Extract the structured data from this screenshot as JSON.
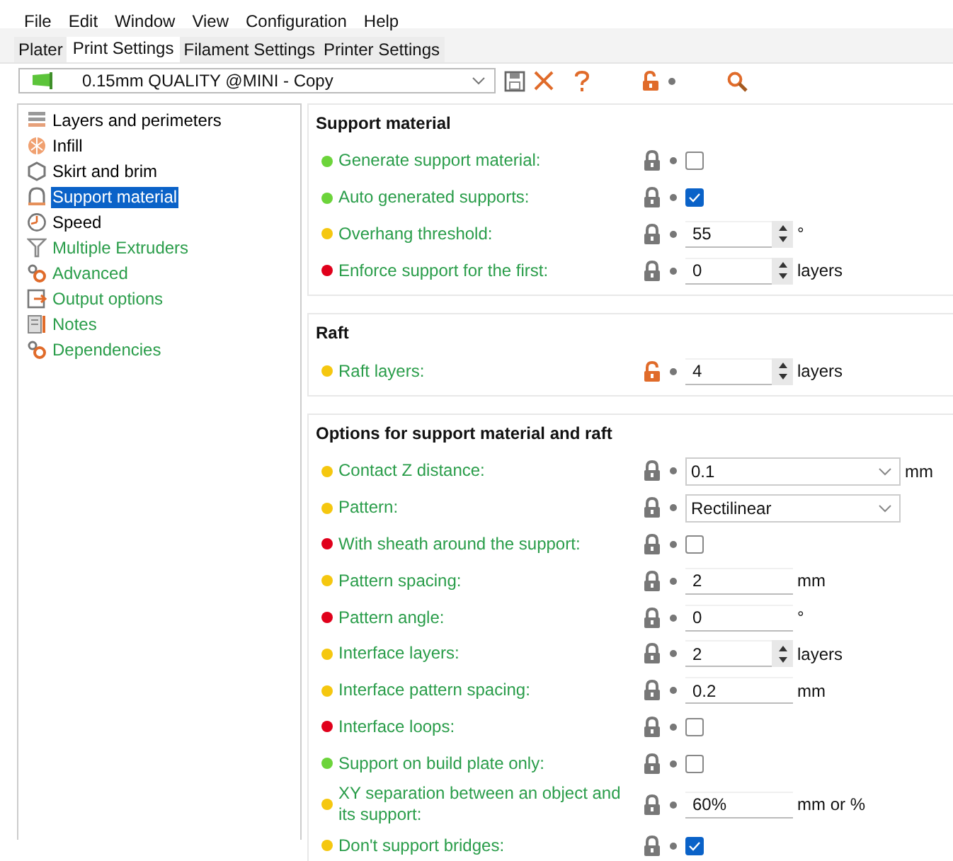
{
  "menu": [
    "File",
    "Edit",
    "Window",
    "View",
    "Configuration",
    "Help"
  ],
  "tabs": [
    {
      "label": "Plater",
      "selected": false
    },
    {
      "label": "Print Settings",
      "selected": true
    },
    {
      "label": "Filament Settings",
      "selected": false
    },
    {
      "label": "Printer Settings",
      "selected": false
    }
  ],
  "preset": {
    "value": "0.15mm QUALITY @MINI - Copy"
  },
  "sidebar": {
    "items": [
      {
        "label": "Layers and perimeters",
        "selected": false,
        "color": "#000000"
      },
      {
        "label": "Infill",
        "selected": false,
        "color": "#000000"
      },
      {
        "label": "Skirt and brim",
        "selected": false,
        "color": "#000000"
      },
      {
        "label": "Support material",
        "selected": true
      },
      {
        "label": "Speed",
        "selected": false,
        "color": "#000000"
      },
      {
        "label": "Multiple Extruders",
        "selected": false,
        "color": "#2a9d4a"
      },
      {
        "label": "Advanced",
        "selected": false,
        "color": "#2a9d4a"
      },
      {
        "label": "Output options",
        "selected": false,
        "color": "#2a9d4a"
      },
      {
        "label": "Notes",
        "selected": false,
        "color": "#2a9d4a"
      },
      {
        "label": "Dependencies",
        "selected": false,
        "color": "#2a9d4a"
      }
    ]
  },
  "sections": [
    {
      "title": "Support material",
      "rows": [
        {
          "label": "Generate support material:",
          "color": "#6cd43a",
          "locked": true,
          "kind": "checkbox",
          "checked": false
        },
        {
          "label": "Auto generated supports:",
          "color": "#6cd43a",
          "locked": true,
          "kind": "checkbox",
          "checked": true
        },
        {
          "label": "Overhang threshold:",
          "color": "#f5c70f",
          "locked": true,
          "kind": "spin",
          "value": "55",
          "unit": "°"
        },
        {
          "label": "Enforce support for the first:",
          "color": "#e0001b",
          "locked": true,
          "kind": "spin",
          "value": "0",
          "unit": "layers"
        }
      ]
    },
    {
      "title": "Raft",
      "rows": [
        {
          "label": "Raft layers:",
          "color": "#f5c70f",
          "locked": false,
          "kind": "spin",
          "value": "4",
          "unit": "layers"
        }
      ]
    },
    {
      "title": "Options for support material and raft",
      "rows": [
        {
          "label": "Contact Z distance:",
          "color": "#f5c70f",
          "locked": true,
          "kind": "combo",
          "value": "0.1",
          "unit": "mm"
        },
        {
          "label": "Pattern:",
          "color": "#f5c70f",
          "locked": true,
          "kind": "combo",
          "value": "Rectilinear"
        },
        {
          "label": "With sheath around the support:",
          "color": "#e0001b",
          "locked": true,
          "kind": "checkbox",
          "checked": false
        },
        {
          "label": "Pattern spacing:",
          "color": "#f5c70f",
          "locked": true,
          "kind": "text",
          "value": "2",
          "unit": "mm"
        },
        {
          "label": "Pattern angle:",
          "color": "#e0001b",
          "locked": true,
          "kind": "text",
          "value": "0",
          "unit": "°"
        },
        {
          "label": "Interface layers:",
          "color": "#f5c70f",
          "locked": true,
          "kind": "spin",
          "value": "2",
          "unit": "layers"
        },
        {
          "label": "Interface pattern spacing:",
          "color": "#f5c70f",
          "locked": true,
          "kind": "text",
          "value": "0.2",
          "unit": "mm"
        },
        {
          "label": "Interface loops:",
          "color": "#e0001b",
          "locked": true,
          "kind": "checkbox",
          "checked": false
        },
        {
          "label": "Support on build plate only:",
          "color": "#6cd43a",
          "locked": true,
          "kind": "checkbox",
          "checked": false
        },
        {
          "label": "XY separation between an object and its support:",
          "color": "#f5c70f",
          "locked": true,
          "kind": "text",
          "value": "60%",
          "unit": "mm or %"
        },
        {
          "label": "Don't support bridges:",
          "color": "#f5c70f",
          "locked": true,
          "kind": "checkbox",
          "checked": true
        }
      ]
    }
  ]
}
